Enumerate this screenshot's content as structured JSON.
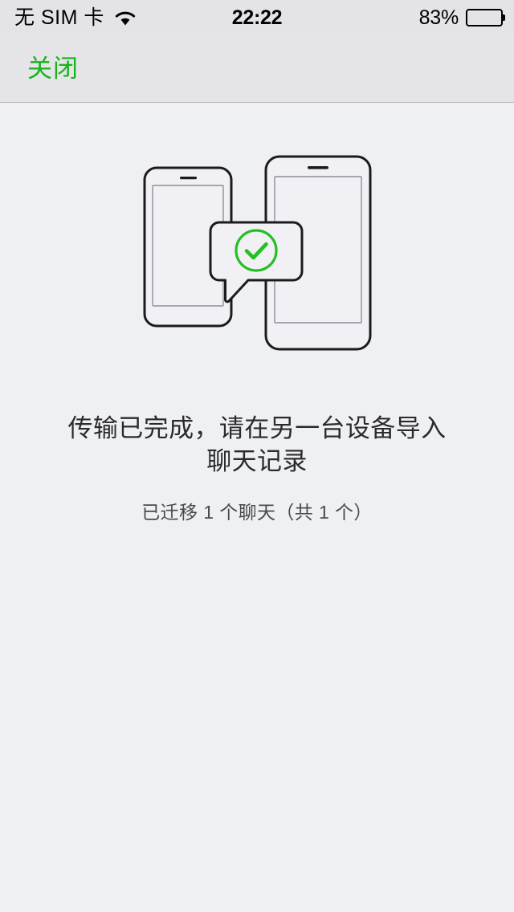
{
  "status_bar": {
    "carrier": "无 SIM 卡",
    "wifi_icon": "wifi-icon",
    "time": "22:22",
    "battery_percent": "83%",
    "battery_level": 83
  },
  "nav_bar": {
    "close_label": "关闭"
  },
  "illustration": {
    "name": "two-phones-transfer-complete-illustration",
    "left_phone": "phone-outline-small",
    "right_phone": "phone-outline-large",
    "bubble": "speech-bubble",
    "check_icon": "check-circle-icon"
  },
  "main": {
    "headline_line1": "传输已完成，请在另一台设备导入",
    "headline_line2": "聊天记录",
    "subline": "已迁移 1 个聊天（共 1 个）"
  },
  "colors": {
    "accent_green": "#16b516",
    "background": "#eff0f4",
    "nav_background": "#e4e4e9",
    "status_background": "#e3e3e8",
    "text_primary": "#2b2b2e",
    "text_secondary": "#4a4a4e",
    "outline_dark": "#1b1b1f",
    "outline_light": "#9a9aa0"
  }
}
